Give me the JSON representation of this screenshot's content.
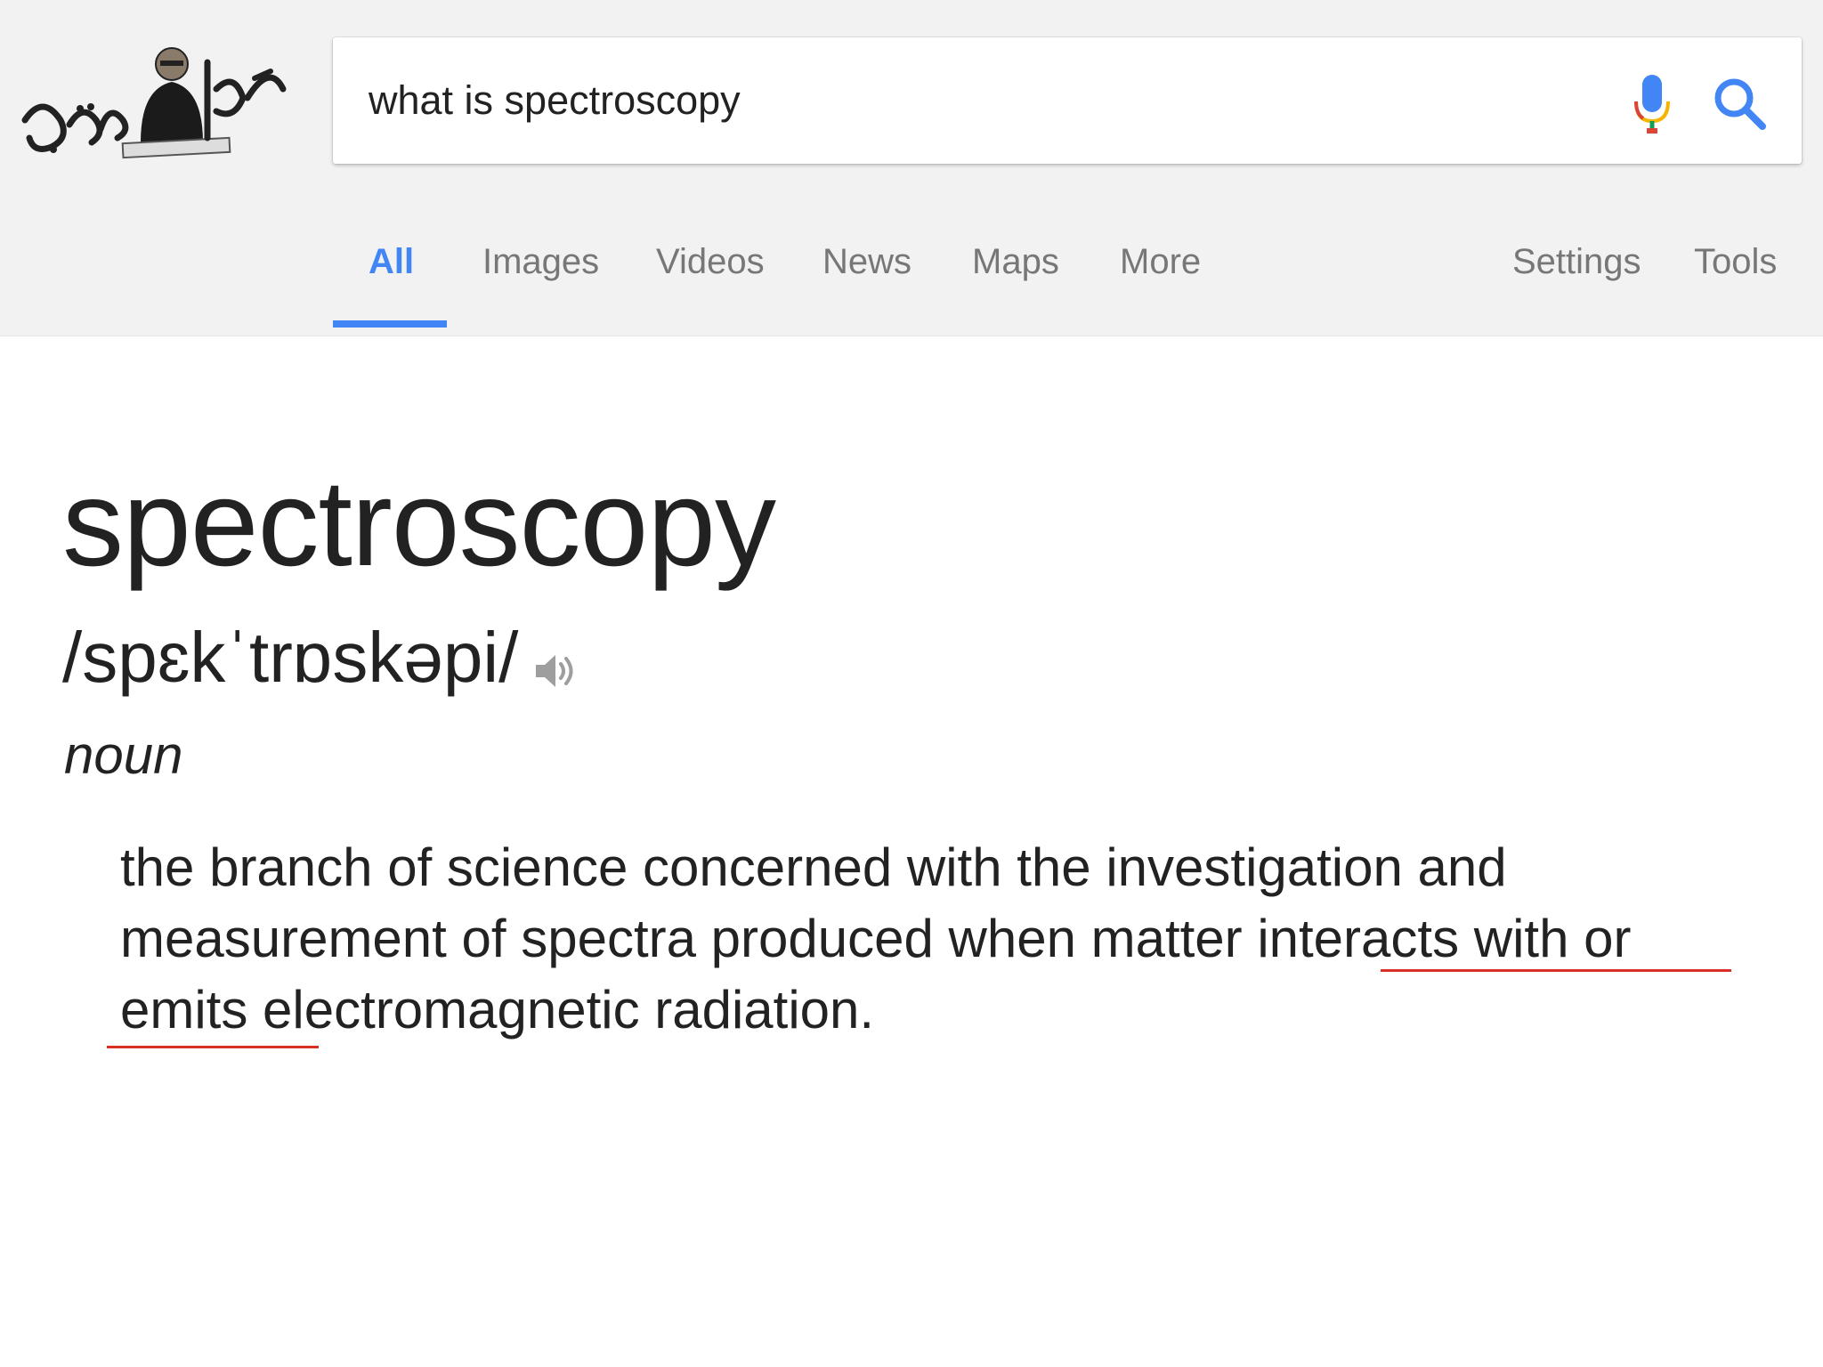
{
  "search": {
    "query": "what is spectroscopy"
  },
  "tabs": [
    {
      "label": "All"
    },
    {
      "label": "Images"
    },
    {
      "label": "Videos"
    },
    {
      "label": "News"
    },
    {
      "label": "Maps"
    },
    {
      "label": "More"
    }
  ],
  "tools": {
    "settings_label": "Settings",
    "tools_label": "Tools"
  },
  "dictionary": {
    "word": "spectroscopy",
    "phonetic": "/spɛkˈtrɒskəpi/",
    "part_of_speech": "noun",
    "definition": "the branch of science concerned with the investigation and measurement of spectra produced when matter interacts with or emits electromagnetic radiation."
  },
  "colors": {
    "accent": "#4285f4",
    "header_bg": "#f2f2f2",
    "text": "#222222",
    "muted": "#777777",
    "spell_underline": "#d93025"
  },
  "icons": {
    "logo": "doodle-logo",
    "mic": "microphone-icon",
    "search": "search-icon",
    "speaker": "speaker-icon"
  }
}
